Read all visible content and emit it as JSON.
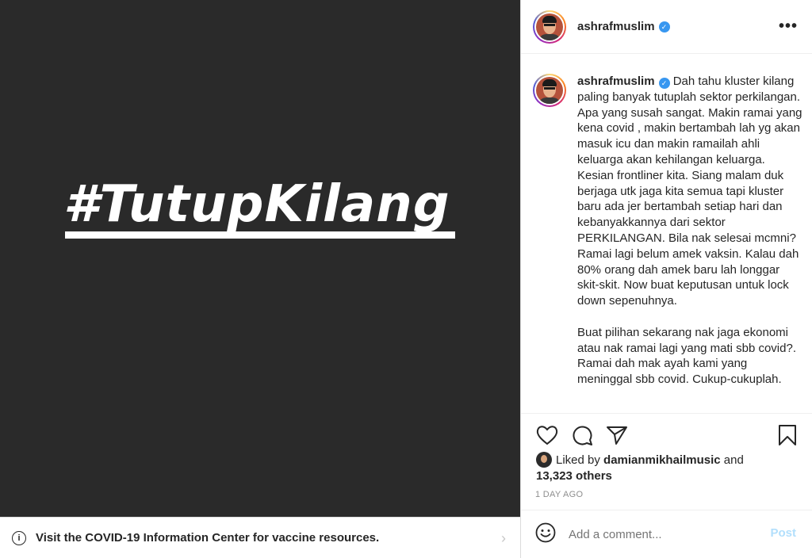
{
  "post": {
    "hashtag": "#TutupKilang"
  },
  "covid_banner": {
    "info_icon": "info-icon",
    "text": "Visit the COVID-19 Information Center for vaccine resources.",
    "chevron": "›"
  },
  "author": {
    "username": "ashrafmuslim",
    "verified": "✓",
    "more": "•••"
  },
  "caption": {
    "username": "ashrafmuslim",
    "paragraphs": [
      "Dah tahu kluster kilang paling banyak tutuplah sektor perkilangan. Apa yang susah sangat. Makin ramai yang kena covid , makin bertambah lah yg akan masuk icu dan makin ramailah ahli keluarga akan kehilangan keluarga. Kesian frontliner kita. Siang malam duk berjaga utk jaga kita semua tapi kluster baru ada jer bertambah setiap hari dan kebanyakkannya dari sektor PERKILANGAN. Bila nak selesai mcmni? Ramai lagi belum amek vaksin. Kalau dah 80% orang dah amek baru lah longgar skit-skit. Now buat keputusan untuk lock down sepenuhnya.",
      "Buat pilihan sekarang nak jaga ekonomi atau nak ramai lagi yang mati sbb covid?. Ramai dah mak ayah kami yang meninggal sbb covid. Cukup-cukuplah."
    ]
  },
  "actions": {
    "icons": [
      "heart-icon",
      "comment-icon",
      "share-icon",
      "bookmark-icon"
    ]
  },
  "likes": {
    "prefix": "Liked by",
    "user": "damianmikhailmusic",
    "and": "and",
    "others": "13,323 others"
  },
  "timestamp": "1 DAY AGO",
  "comment": {
    "placeholder": "Add a comment...",
    "post_label": "Post"
  }
}
